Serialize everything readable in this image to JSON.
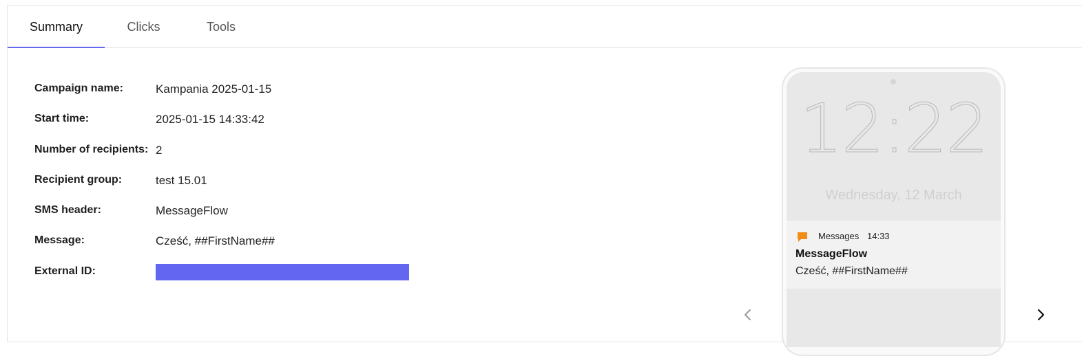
{
  "tabs": [
    {
      "label": "Summary",
      "active": true
    },
    {
      "label": "Clicks",
      "active": false
    },
    {
      "label": "Tools",
      "active": false
    }
  ],
  "details": {
    "campaign_name": {
      "label": "Campaign name:",
      "value": "Kampania 2025-01-15"
    },
    "start_time": {
      "label": "Start time:",
      "value": "2025-01-15 14:33:42"
    },
    "recipients": {
      "label": "Number of recipients:",
      "value": "2"
    },
    "recipient_group": {
      "label": "Recipient group:",
      "value": "test 15.01"
    },
    "sms_header": {
      "label": "SMS header:",
      "value": "MessageFlow"
    },
    "message": {
      "label": "Message:",
      "value": "Cześć, ##FirstName##"
    },
    "external_id": {
      "label": "External ID:",
      "value": ""
    }
  },
  "preview": {
    "clock": "12:22",
    "date": "Wednesday, 12 March",
    "notification": {
      "app": "Messages",
      "time": "14:33",
      "title": "MessageFlow",
      "body": "Cześć, ##FirstName##"
    }
  },
  "icons": {
    "prev": "chevron-left-icon",
    "next": "chevron-right-icon",
    "notification": "chat-bubble-icon"
  },
  "colors": {
    "accent": "#6366f1",
    "notification_icon": "#f28c18"
  }
}
